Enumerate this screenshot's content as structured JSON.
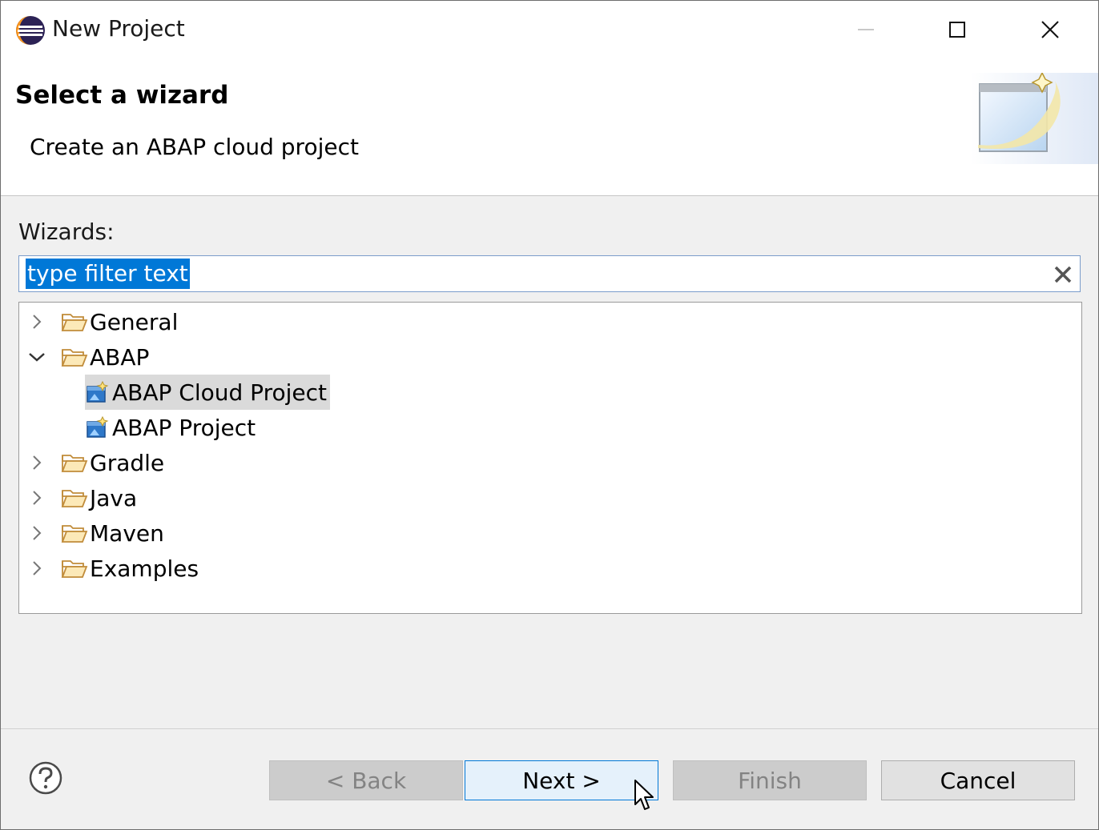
{
  "window": {
    "title": "New Project",
    "app_icon": "eclipse-icon",
    "controls": [
      "minimize-icon",
      "maximize-icon",
      "close-icon"
    ]
  },
  "banner": {
    "title": "Select a wizard",
    "description": "Create an ABAP cloud project",
    "graphic": "new-wizard-banner-icon"
  },
  "wizards": {
    "label": "Wizards:",
    "filter_value": "type filter text",
    "filter_clear_icon": "clear-icon",
    "tree": [
      {
        "label": "General",
        "expanded": false,
        "icon": "folder-icon"
      },
      {
        "label": "ABAP",
        "expanded": true,
        "icon": "folder-icon",
        "children": [
          {
            "label": "ABAP Cloud Project",
            "selected": true,
            "icon": "abap-project-icon"
          },
          {
            "label": "ABAP Project",
            "selected": false,
            "icon": "abap-project-icon"
          }
        ]
      },
      {
        "label": "Gradle",
        "expanded": false,
        "icon": "folder-icon"
      },
      {
        "label": "Java",
        "expanded": false,
        "icon": "folder-icon"
      },
      {
        "label": "Maven",
        "expanded": false,
        "icon": "folder-icon"
      },
      {
        "label": "Examples",
        "expanded": false,
        "icon": "folder-icon"
      }
    ]
  },
  "buttons": {
    "help_icon": "help-icon",
    "back": "< Back",
    "next": "Next >",
    "finish": "Finish",
    "cancel": "Cancel"
  },
  "colors": {
    "selection_blue": "#0078d7",
    "tree_selected": "#dadada",
    "dialog_bg": "#f0f0f0"
  }
}
